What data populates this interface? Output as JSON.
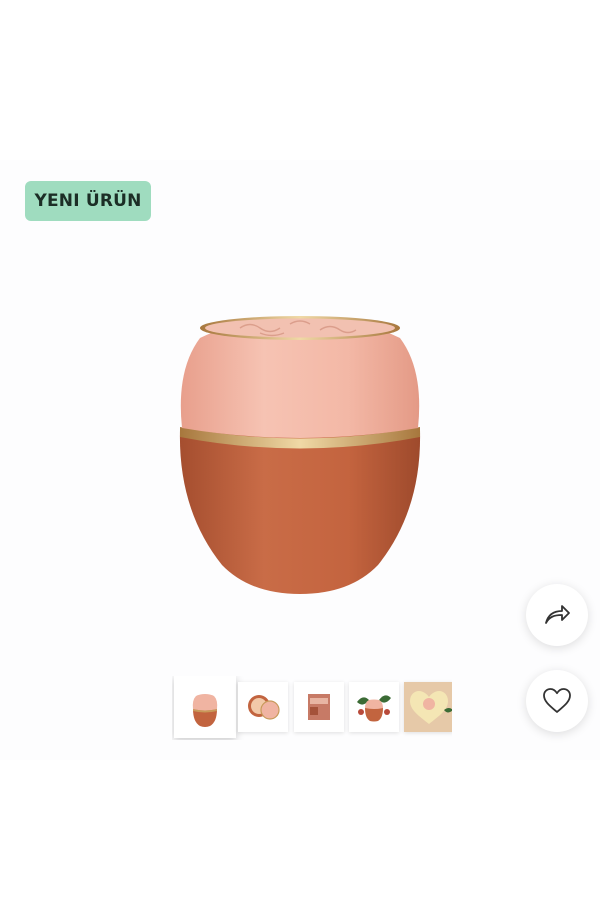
{
  "badge": {
    "label": "YENI ÜRÜN",
    "background": "#9fdcbf",
    "text_color": "#1c2e26"
  },
  "actions": {
    "share_icon": "share-arrow-icon",
    "favorite_icon": "heart-outline-icon"
  },
  "gallery": {
    "thumbnail_count": 5,
    "selected_index": 0
  },
  "colors": {
    "lid": "#f0b4a2",
    "jar": "#c2643f",
    "gold_ring": "#c89a5a"
  }
}
